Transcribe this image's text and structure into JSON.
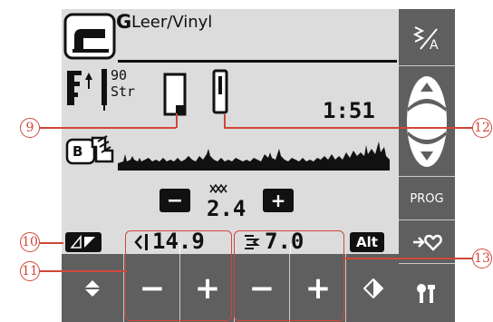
{
  "header": {
    "stitch_letter": "G",
    "program_name": "Leer/Vinyl",
    "presser_foot_label": "90",
    "presser_foot_sub": "Str",
    "time_value": "1:51"
  },
  "sequence": {
    "letter": "B"
  },
  "stitch_length": {
    "value": "2.4",
    "minus": "−",
    "plus": "+"
  },
  "width_control": {
    "value": "14.9"
  },
  "length_control": {
    "value": "7.0"
  },
  "alt_label": "Alt",
  "prog_label": "PROG",
  "bottom_buttons": {
    "width_minus": "−",
    "width_plus": "+",
    "length_minus": "−",
    "length_plus": "+"
  },
  "callouts": [
    "9",
    "10",
    "11",
    "12",
    "13"
  ],
  "colors": {
    "screen_bg": "#dcdcdc",
    "panel_bg": "#5f5f5f",
    "callout": "#d0473a"
  }
}
